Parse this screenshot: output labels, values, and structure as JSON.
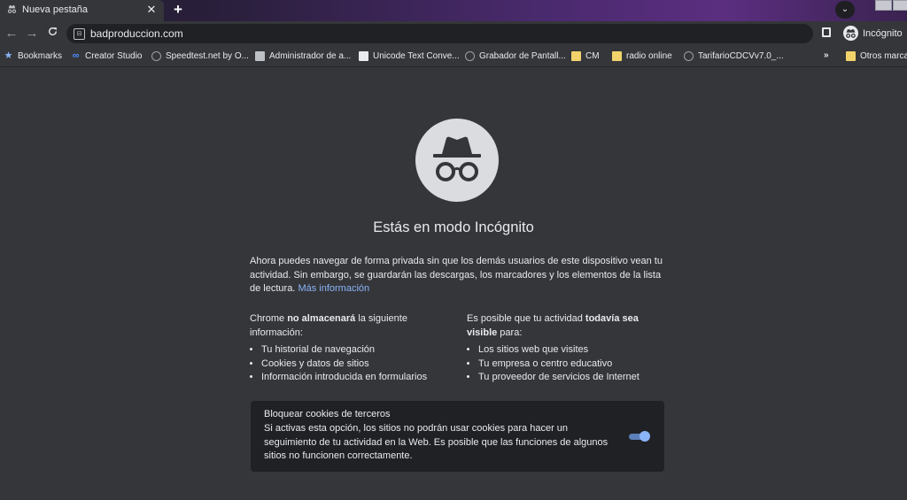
{
  "tab": {
    "title": "Nueva pestaña",
    "close_icon": "close-icon"
  },
  "toolbar": {
    "url": "badproduccion.com",
    "incognito_label": "Incógnito"
  },
  "bookmarks": [
    {
      "label": "Bookmarks",
      "icon": "star-icon"
    },
    {
      "label": "Creator Studio",
      "icon": "meta-icon"
    },
    {
      "label": "Speedtest.net by O...",
      "icon": "globe-icon"
    },
    {
      "label": "Administrador de a...",
      "icon": "page-icon"
    },
    {
      "label": "Unicode Text Conve...",
      "icon": "page-icon"
    },
    {
      "label": "Grabador de Pantall...",
      "icon": "globe-icon"
    },
    {
      "label": "CM",
      "icon": "folder-icon"
    },
    {
      "label": "radio online",
      "icon": "folder-icon"
    },
    {
      "label": "TarifarioCDCVv7.0_...",
      "icon": "globe-icon"
    },
    {
      "label": "Otros marcad",
      "icon": "folder-icon"
    }
  ],
  "overflow_label": "»",
  "main": {
    "heading": "Estás en modo Incógnito",
    "intro": "Ahora puedes navegar de forma privada sin que los demás usuarios de este dispositivo vean tu actividad. Sin embargo, se guardarán las descargas, los marcadores y los elementos de la lista de lectura.",
    "learn_more": "Más información",
    "left": {
      "pre": "Chrome ",
      "bold": "no almacenará",
      "post": " la siguiente información:",
      "items": [
        "Tu historial de navegación",
        "Cookies y datos de sitios",
        "Información introducida en formularios"
      ]
    },
    "right": {
      "pre": "Es posible que tu actividad ",
      "bold": "todavía sea visible",
      "post": " para:",
      "items": [
        "Los sitios web que visites",
        "Tu empresa o centro educativo",
        "Tu proveedor de servicios de Internet"
      ]
    },
    "cookies": {
      "title": "Bloquear cookies de terceros",
      "description": "Si activas esta opción, los sitios no podrán usar cookies para hacer un seguimiento de tu actividad en la Web. Es posible que las funciones de algunos sitios no funcionen correctamente.",
      "enabled": true
    }
  }
}
